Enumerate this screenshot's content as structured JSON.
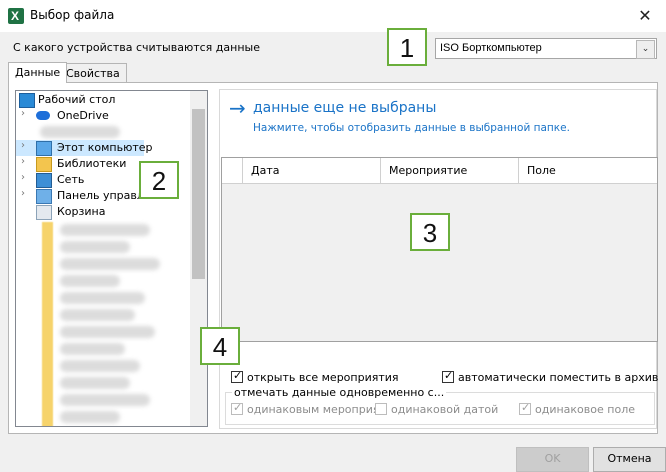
{
  "window": {
    "title": "Выбор файла",
    "close_glyph": "✕",
    "app_icon_letter": "X"
  },
  "device": {
    "label": "С какого устройства считываются данные",
    "selected": "ISO Борткомпьютер",
    "arrow_glyph": "⌄"
  },
  "tabs": [
    {
      "label": "Данные",
      "active": true
    },
    {
      "label": "Свойства",
      "active": false
    }
  ],
  "tree": {
    "items": [
      {
        "label": "Рабочий стол",
        "icon": "desktop-icon",
        "expandable": false
      },
      {
        "label": "OneDrive",
        "icon": "cloud-icon",
        "expandable": true
      },
      {
        "label": "Этот компьютер",
        "icon": "computer-icon",
        "expandable": true,
        "selected": true
      },
      {
        "label": "Библиотеки",
        "icon": "library-icon",
        "expandable": true
      },
      {
        "label": "Сеть",
        "icon": "network-icon",
        "expandable": true
      },
      {
        "label": "Панель управле",
        "icon": "control-panel-icon",
        "expandable": true
      },
      {
        "label": "Корзина",
        "icon": "recycle-bin-icon",
        "expandable": false
      }
    ],
    "chevron_glyph": "›"
  },
  "status": {
    "arrow_glyph": "→",
    "title": "данные еще не выбраны",
    "hint": "Нажмите, чтобы отобразить данные в выбранной папке."
  },
  "grid": {
    "columns": [
      "Дата",
      "Мероприятие",
      "Поле"
    ]
  },
  "options": {
    "open_all": {
      "label": "открыть все мероприятия",
      "checked": true
    },
    "auto_archive": {
      "label": "автоматически поместить в архив",
      "checked": true
    },
    "group_caption": "отмечать данные одновременно с...",
    "same_event": {
      "label": "одинаковым мероприят",
      "checked": true,
      "disabled": true
    },
    "same_date": {
      "label": "одинаковой датой",
      "checked": false,
      "disabled": true
    },
    "same_field": {
      "label": "одинаковое поле",
      "checked": true,
      "disabled": true
    }
  },
  "buttons": {
    "ok": "OK",
    "cancel": "Отмена"
  },
  "callouts": [
    "1",
    "2",
    "3",
    "4"
  ],
  "colors": {
    "link": "#1a73c7",
    "callout_border": "#6aae3b",
    "excel_green": "#1f7244"
  }
}
